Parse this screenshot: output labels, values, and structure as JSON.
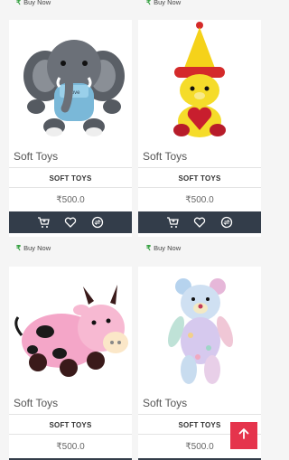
{
  "buy_now_label": "Buy Now",
  "accent_color": "#e5344c",
  "action_bar_color": "#333d4a",
  "rupee_color": "#2e9e3a",
  "products": [
    {
      "title": "Soft Toys",
      "category": "SOFT TOYS",
      "price": "₹500.0",
      "image": "grey-elephant-plush"
    },
    {
      "title": "Soft Toys",
      "category": "SOFT TOYS",
      "price": "₹500.0",
      "image": "yellow-teddy-with-hat-and-heart"
    },
    {
      "title": "Soft Toys",
      "category": "SOFT TOYS",
      "price": "₹500.0",
      "image": "pink-cow-plush"
    },
    {
      "title": "Soft Toys",
      "category": "SOFT TOYS",
      "price": "₹500.0",
      "image": "pastel-teddy-bear"
    }
  ],
  "icons": {
    "cart": "cart-icon",
    "wishlist": "heart-icon",
    "compare": "compare-icon",
    "scroll_top": "arrow-up-icon"
  }
}
